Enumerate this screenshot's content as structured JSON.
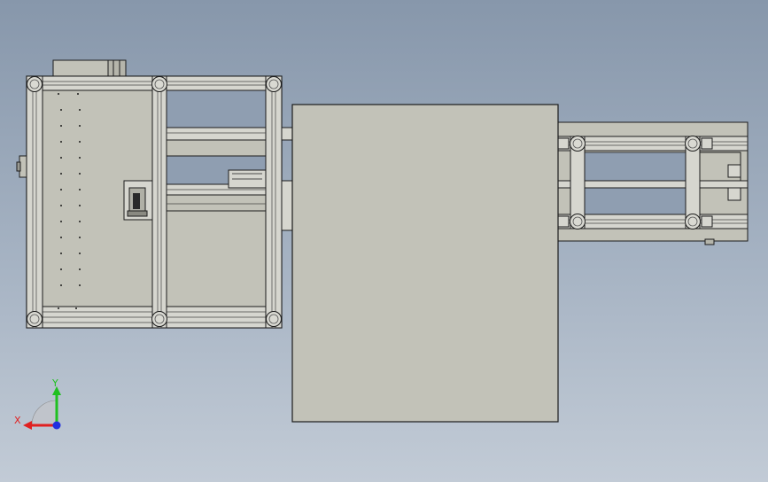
{
  "viewport": {
    "background_top": "#8797ab",
    "background_bottom": "#c2cbd6",
    "part_fill": "#c2c2b8",
    "part_edge": "#1c1c1c",
    "profile_fill": "#d6d6cf"
  },
  "triad": {
    "x_label": "X",
    "y_label": "Y",
    "x_axis_color": "#e02020",
    "y_axis_color": "#20c020",
    "z_axis_color": "#2030e0"
  }
}
